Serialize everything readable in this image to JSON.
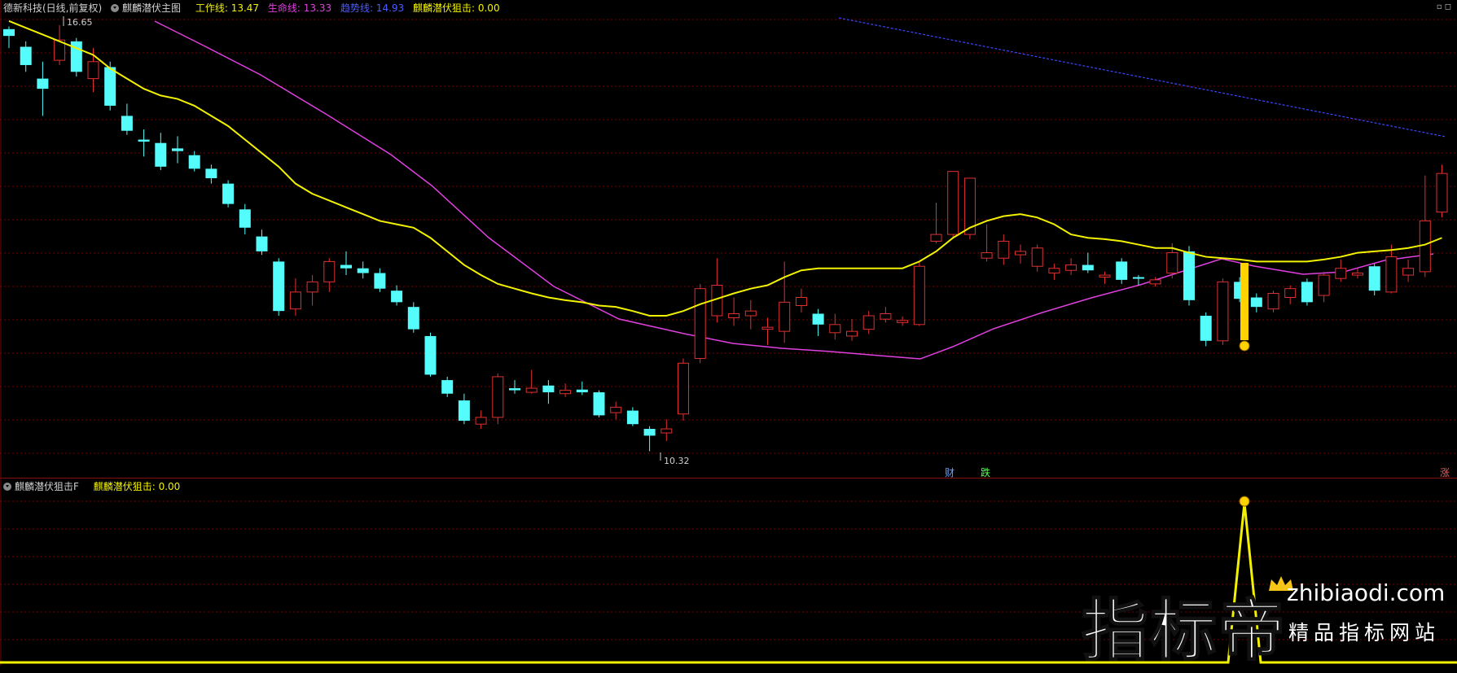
{
  "main_header": {
    "stock": "德新科技(日线,前复权)",
    "indicator": "麒麟潜伏主图",
    "work_line": "工作线: 13.47",
    "life_line": "生命线: 13.33",
    "trend_line": "趋势线: 14.93",
    "snipe": "麒麟潜伏狙击: 0.00"
  },
  "sub_header": {
    "indicator": "麒麟潜伏狙击F",
    "snipe": "麒麟潜伏狙击: 0.00"
  },
  "top_right_icons": "▫◻",
  "price_labels": {
    "high": "16.65",
    "low": "10.32"
  },
  "signals": {
    "cai": "财",
    "die": "跌",
    "zhang": "涨转"
  },
  "watermark": {
    "cn": "指标帝",
    "site": "zhibiaodi.com",
    "slogan": "精品指标网站"
  },
  "colors": {
    "bg": "#000000",
    "grid": "#7a0000",
    "up": "#e03030",
    "down": "#54fcfc",
    "work": "#f2f200",
    "life": "#e040e0",
    "trend": "#3c46ff"
  },
  "chart_data": {
    "type": "candlestick",
    "price_range": [
      10.32,
      16.65
    ],
    "candles": [
      [
        16.58,
        16.48,
        16.62,
        16.3,
        "d"
      ],
      [
        16.32,
        16.05,
        16.4,
        15.95,
        "d"
      ],
      [
        15.85,
        15.7,
        16.1,
        15.3,
        "d"
      ],
      [
        16.12,
        16.42,
        16.64,
        16.05,
        "u"
      ],
      [
        16.4,
        15.95,
        16.45,
        15.88,
        "d"
      ],
      [
        15.85,
        16.1,
        16.3,
        15.65,
        "u"
      ],
      [
        16.02,
        15.45,
        16.1,
        15.38,
        "d"
      ],
      [
        15.3,
        15.08,
        15.48,
        15.02,
        "d"
      ],
      [
        14.95,
        14.92,
        15.1,
        14.7,
        "d"
      ],
      [
        14.9,
        14.55,
        15.05,
        14.5,
        "d"
      ],
      [
        14.82,
        14.78,
        15.0,
        14.6,
        "d"
      ],
      [
        14.72,
        14.52,
        14.78,
        14.48,
        "d"
      ],
      [
        14.52,
        14.38,
        14.58,
        14.3,
        "d"
      ],
      [
        14.3,
        14.0,
        14.35,
        13.95,
        "d"
      ],
      [
        13.92,
        13.65,
        14.0,
        13.55,
        "d"
      ],
      [
        13.52,
        13.3,
        13.62,
        13.25,
        "d"
      ],
      [
        13.15,
        12.42,
        13.2,
        12.35,
        "d"
      ],
      [
        12.45,
        12.7,
        12.9,
        12.35,
        "u"
      ],
      [
        12.7,
        12.85,
        12.95,
        12.5,
        "u"
      ],
      [
        12.85,
        13.15,
        13.2,
        12.7,
        "u"
      ],
      [
        13.1,
        13.05,
        13.3,
        12.95,
        "d"
      ],
      [
        13.05,
        12.98,
        13.15,
        12.9,
        "d"
      ],
      [
        12.98,
        12.75,
        13.05,
        12.7,
        "d"
      ],
      [
        12.72,
        12.55,
        12.8,
        12.5,
        "d"
      ],
      [
        12.48,
        12.15,
        12.55,
        12.1,
        "d"
      ],
      [
        12.05,
        11.48,
        12.1,
        11.45,
        "d"
      ],
      [
        11.4,
        11.2,
        11.45,
        11.15,
        "d"
      ],
      [
        11.1,
        10.8,
        11.2,
        10.75,
        "d"
      ],
      [
        10.75,
        10.85,
        10.95,
        10.68,
        "u"
      ],
      [
        10.85,
        11.45,
        11.5,
        10.75,
        "u"
      ],
      [
        11.28,
        11.25,
        11.4,
        11.2,
        "d"
      ],
      [
        11.22,
        11.28,
        11.55,
        11.2,
        "u"
      ],
      [
        11.32,
        11.22,
        11.4,
        11.05,
        "d"
      ],
      [
        11.2,
        11.25,
        11.35,
        11.15,
        "u"
      ],
      [
        11.26,
        11.22,
        11.38,
        11.18,
        "d"
      ],
      [
        11.22,
        10.88,
        11.25,
        10.85,
        "d"
      ],
      [
        10.92,
        11.0,
        11.08,
        10.82,
        "u"
      ],
      [
        10.95,
        10.75,
        11.0,
        10.72,
        "d"
      ],
      [
        10.68,
        10.58,
        10.72,
        10.35,
        "d"
      ],
      [
        10.62,
        10.68,
        10.82,
        10.5,
        "u"
      ],
      [
        10.9,
        11.65,
        11.72,
        10.8,
        "u"
      ],
      [
        11.72,
        12.75,
        12.82,
        11.65,
        "u"
      ],
      [
        12.35,
        12.8,
        13.2,
        12.25,
        "u"
      ],
      [
        12.32,
        12.38,
        12.62,
        12.2,
        "u"
      ],
      [
        12.35,
        12.42,
        12.58,
        12.15,
        "u"
      ],
      [
        12.15,
        12.18,
        12.32,
        11.92,
        "u"
      ],
      [
        12.12,
        12.55,
        13.15,
        11.95,
        "u"
      ],
      [
        12.5,
        12.62,
        12.75,
        12.4,
        "u"
      ],
      [
        12.38,
        12.22,
        12.45,
        12.05,
        "d"
      ],
      [
        12.1,
        12.22,
        12.38,
        12.0,
        "u"
      ],
      [
        12.05,
        12.12,
        12.3,
        11.98,
        "u"
      ],
      [
        12.15,
        12.35,
        12.42,
        12.08,
        "u"
      ],
      [
        12.3,
        12.38,
        12.48,
        12.25,
        "u"
      ],
      [
        12.25,
        12.28,
        12.34,
        12.2,
        "u"
      ],
      [
        12.22,
        13.08,
        13.15,
        12.2,
        "u"
      ],
      [
        13.45,
        13.55,
        14.02,
        13.42,
        "u"
      ],
      [
        13.55,
        14.48,
        14.48,
        13.5,
        "u"
      ],
      [
        13.55,
        14.38,
        14.38,
        13.48,
        "u"
      ],
      [
        13.2,
        13.28,
        13.7,
        13.15,
        "u"
      ],
      [
        13.2,
        13.45,
        13.55,
        13.1,
        "u"
      ],
      [
        13.25,
        13.3,
        13.4,
        13.12,
        "u"
      ],
      [
        13.08,
        13.35,
        13.4,
        13.0,
        "u"
      ],
      [
        12.98,
        13.05,
        13.12,
        12.88,
        "u"
      ],
      [
        13.02,
        13.1,
        13.2,
        12.95,
        "u"
      ],
      [
        13.1,
        13.02,
        13.28,
        12.98,
        "d"
      ],
      [
        12.92,
        12.95,
        13.0,
        12.82,
        "u"
      ],
      [
        13.15,
        12.88,
        13.2,
        12.82,
        "d"
      ],
      [
        12.9,
        12.92,
        12.95,
        12.8,
        "d"
      ],
      [
        12.82,
        12.88,
        12.92,
        12.78,
        "u"
      ],
      [
        12.98,
        13.28,
        13.42,
        12.9,
        "u"
      ],
      [
        13.3,
        12.58,
        13.38,
        12.5,
        "d"
      ],
      [
        12.35,
        11.98,
        12.4,
        11.9,
        "d"
      ],
      [
        11.98,
        12.85,
        12.9,
        11.92,
        "u"
      ],
      [
        12.85,
        12.6,
        12.92,
        12.55,
        "d"
      ],
      [
        12.62,
        12.48,
        12.68,
        12.4,
        "d"
      ],
      [
        12.45,
        12.68,
        12.72,
        12.4,
        "u"
      ],
      [
        12.62,
        12.75,
        12.8,
        12.52,
        "u"
      ],
      [
        12.85,
        12.55,
        12.9,
        12.5,
        "d"
      ],
      [
        12.65,
        12.95,
        13.0,
        12.55,
        "u"
      ],
      [
        12.9,
        13.05,
        13.18,
        12.85,
        "u"
      ],
      [
        12.95,
        12.98,
        13.05,
        12.9,
        "u"
      ],
      [
        13.08,
        12.72,
        13.12,
        12.65,
        "d"
      ],
      [
        12.7,
        13.22,
        13.4,
        12.68,
        "u"
      ],
      [
        12.95,
        13.05,
        13.18,
        12.85,
        "u"
      ],
      [
        13.0,
        13.75,
        14.42,
        12.92,
        "u"
      ],
      [
        13.88,
        14.45,
        14.58,
        13.8,
        "u"
      ]
    ],
    "work_line": [
      16.7,
      16.6,
      16.5,
      16.4,
      16.3,
      16.2,
      16.0,
      15.85,
      15.7,
      15.6,
      15.55,
      15.45,
      15.3,
      15.15,
      14.95,
      14.75,
      14.55,
      14.3,
      14.15,
      14.05,
      13.95,
      13.85,
      13.75,
      13.7,
      13.65,
      13.5,
      13.3,
      13.1,
      12.95,
      12.82,
      12.75,
      12.68,
      12.62,
      12.58,
      12.55,
      12.5,
      12.48,
      12.42,
      12.35,
      12.35,
      12.42,
      12.52,
      12.6,
      12.68,
      12.75,
      12.8,
      12.92,
      13.02,
      13.05,
      13.05,
      13.05,
      13.05,
      13.05,
      13.05,
      13.15,
      13.3,
      13.5,
      13.65,
      13.75,
      13.82,
      13.85,
      13.8,
      13.7,
      13.55,
      13.5,
      13.48,
      13.45,
      13.4,
      13.35,
      13.35,
      13.28,
      13.22,
      13.2,
      13.18,
      13.15,
      13.15,
      13.15,
      13.15,
      13.18,
      13.22,
      13.28,
      13.3,
      13.32,
      13.35,
      13.4,
      13.5
    ]
  }
}
